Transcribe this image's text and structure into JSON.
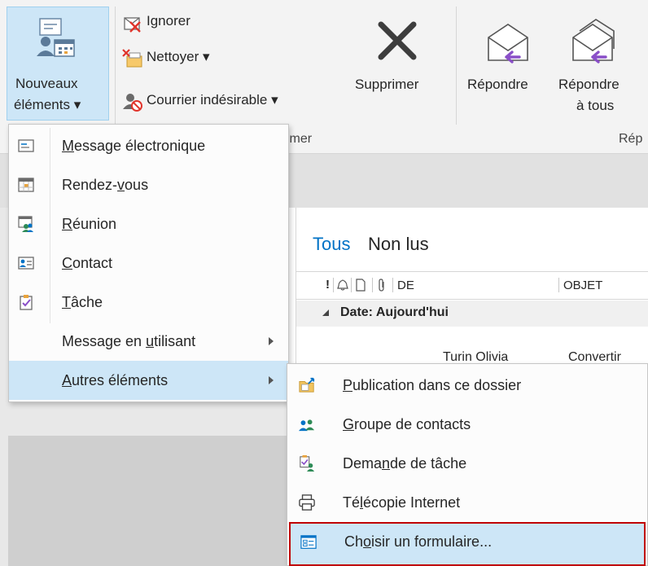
{
  "ribbon": {
    "new_items": {
      "line1": "Nouveaux",
      "line2": "éléments ▾"
    },
    "ignore": "Ignorer",
    "clean": "Nettoyer ▾",
    "junk": "Courrier indésirable ▾",
    "delete": "Supprimer",
    "reply": "Répondre",
    "reply_all": {
      "line1": "Répondre",
      "line2": "à tous"
    },
    "group_delete": "imer",
    "group_respond": "Rép"
  },
  "list": {
    "tab_all": "Tous",
    "tab_unread": "Non lus",
    "col_icons": "!",
    "col_from": "DE",
    "col_subject": "OBJET",
    "group_header": "Date: Aujourd'hui",
    "row1_from": "Turin Olivia",
    "row1_subject": "Convertir"
  },
  "menu": {
    "items": [
      {
        "pre": "",
        "ul": "M",
        "post": "essage électronique"
      },
      {
        "pre": "Rendez-",
        "ul": "v",
        "post": "ous"
      },
      {
        "pre": "",
        "ul": "R",
        "post": "éunion"
      },
      {
        "pre": "",
        "ul": "C",
        "post": "ontact"
      },
      {
        "pre": "",
        "ul": "T",
        "post": "âche"
      },
      {
        "pre": "Message en ",
        "ul": "u",
        "post": "tilisant"
      },
      {
        "pre": "",
        "ul": "A",
        "post": "utres éléments"
      }
    ]
  },
  "submenu": {
    "items": [
      {
        "pre": "",
        "ul": "P",
        "post": "ublication dans ce dossier"
      },
      {
        "pre": "",
        "ul": "G",
        "post": "roupe de contacts"
      },
      {
        "pre": "Dema",
        "ul": "n",
        "post": "de de tâche"
      },
      {
        "pre": "Té",
        "ul": "l",
        "post": "écopie Internet"
      },
      {
        "pre": "Ch",
        "ul": "o",
        "post": "isir un formulaire..."
      }
    ]
  },
  "colors": {
    "accent": "#0072c6",
    "highlight": "#cde6f7",
    "focus_border": "#c00000",
    "purple_arrow": "#8a4fc8"
  }
}
